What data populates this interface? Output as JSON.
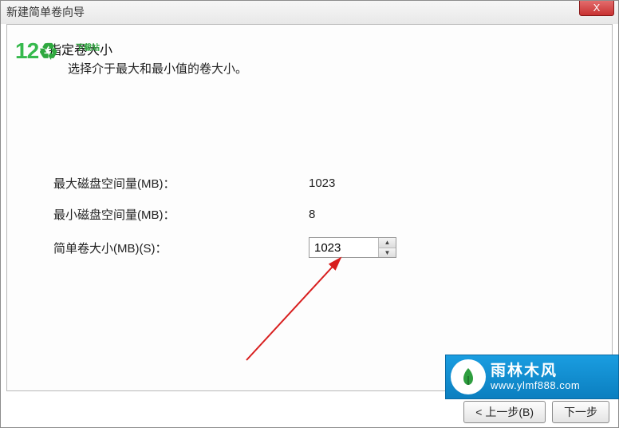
{
  "window": {
    "title": "新建简单卷向导",
    "close_label": "X"
  },
  "header": {
    "title": "指定卷大小",
    "subtitle": "选择介于最大和最小值的卷大小。"
  },
  "watermark": {
    "text_121": "12",
    "small_green": "下载站"
  },
  "form": {
    "max_label": "最大磁盘空间量(MB)：",
    "max_value": "1023",
    "min_label": "最小磁盘空间量(MB)：",
    "min_value": "8",
    "size_label": "简单卷大小(MB)(S)：",
    "size_value": "1023"
  },
  "buttons": {
    "back": "< 上一步(B)",
    "next": "下一步"
  },
  "brand": {
    "cn": "雨林木风",
    "url": "www.ylmf888.com"
  }
}
